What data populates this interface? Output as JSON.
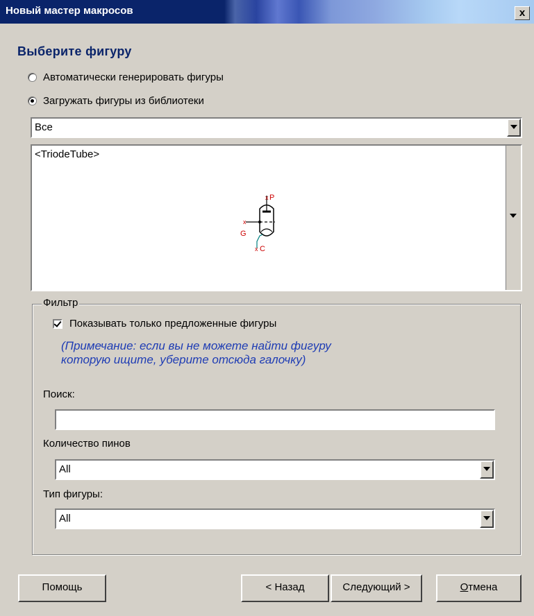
{
  "window": {
    "title": "Новый мастер макросов",
    "close_label": "x"
  },
  "heading": "Выберите фигуру",
  "options": {
    "auto_generate": "Автоматически генерировать фигуры",
    "load_library": "Загружать фигуры из библиотеки",
    "selected": "load_library"
  },
  "library_select": {
    "value": "Все"
  },
  "preview": {
    "name": "<TriodeTube>",
    "pins": [
      "P",
      "G",
      "C"
    ]
  },
  "filter": {
    "group_label": "Фильтр",
    "show_suggested_label": "Показывать только предложенные фигуры",
    "show_suggested_checked": true,
    "note_line1": "(Примечание: если вы не можете найти фигуру",
    "note_line2": "которую ищите, уберите отсюда галочку)",
    "search_label": "Поиск:",
    "search_value": "",
    "pin_count_label": "Количество пинов",
    "pin_count_value": "All",
    "shape_type_label": "Тип фигуры:",
    "shape_type_value": "All"
  },
  "buttons": {
    "help": "Помощь",
    "back": "< Назад",
    "next": "Следующий >",
    "cancel_first": "О",
    "cancel_rest": "тмена"
  },
  "colors": {
    "title_bg": "#0a246a",
    "heading": "#0a246a",
    "note": "#1e3cb4",
    "pin_marker": "#cc0000",
    "pin_teal": "#008080"
  }
}
